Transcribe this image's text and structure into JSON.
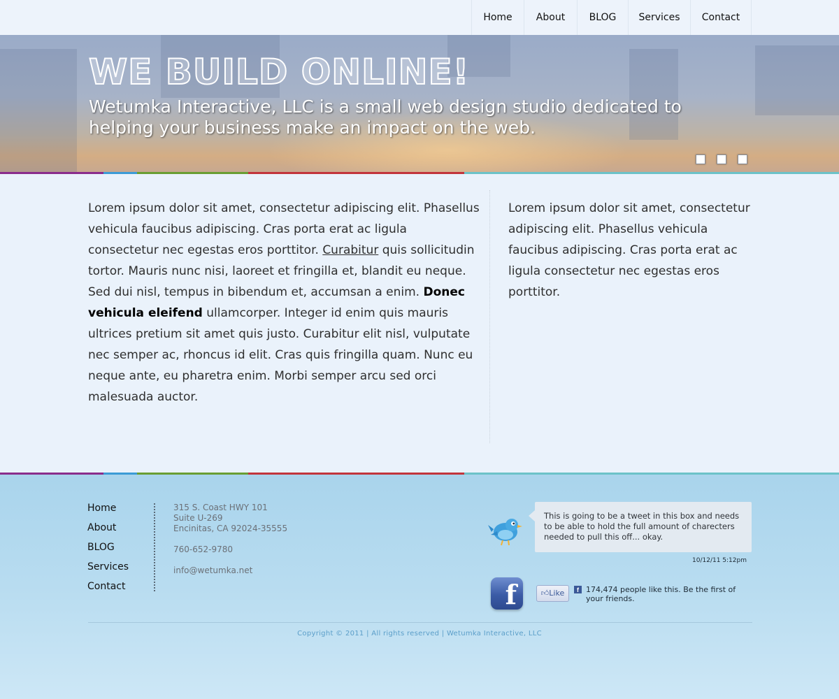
{
  "nav": {
    "items": [
      "Home",
      "About",
      "BLOG",
      "Services",
      "Contact"
    ]
  },
  "hero": {
    "title": "WE BUILD ONLINE!",
    "subtitle": "Wetumka Interactive, LLC is a small web design studio dedicated to helping your business make an impact on the web.",
    "slides": 3
  },
  "main": {
    "left": {
      "text_1": "Lorem ipsum dolor sit amet, consectetur adipiscing elit. Phasellus vehicula faucibus adipiscing. Cras porta erat ac ligula consectetur nec egestas eros porttitor. ",
      "link": "Curabitur",
      "text_2": " quis sollicitudin tortor. Mauris nunc nisi, laoreet et fringilla et, blandit eu neque. Sed dui nisl, tempus in bibendum et, accumsan a enim. ",
      "bold": "Donec vehicula eleifend",
      "text_3": " ullamcorper. Integer id enim quis mauris ultrices pretium sit amet quis justo. Curabitur elit nisl, vulputate nec semper ac, rhoncus id elit. Cras quis fringilla quam. Nunc eu neque ante, eu pharetra enim. Morbi semper arcu sed orci malesuada auctor."
    },
    "right": {
      "text": "Lorem ipsum dolor sit amet, consectetur adipiscing elit. Phasellus vehicula faucibus adipiscing. Cras porta erat ac ligula consectetur nec egestas eros porttitor."
    }
  },
  "footer": {
    "nav": [
      "Home",
      "About",
      "BLOG",
      "Services",
      "Contact"
    ],
    "address": {
      "line1": "315 S. Coast HWY 101",
      "line2": "Suite U-269",
      "line3": "Encinitas, CA 92024-35555",
      "phone": "760-652-9780",
      "email": "info@wetumka.net"
    },
    "tweet": {
      "text": "This is going to be a tweet in this box and needs to be able to hold the full amount of charecters needed to pull this off... okay.",
      "time": "10/12/11 5:12pm",
      "icon": "twitter-bird-icon"
    },
    "facebook": {
      "icon": "facebook-icon",
      "like_label": "Like",
      "count": "174,474",
      "text": " people like this. Be the first of your friends."
    },
    "copyright": "Copyright © 2011 | All rights reserved | Wetumka Interactive, LLC"
  },
  "colors": {
    "stripe": [
      "#8a2d8c",
      "#3c9bd6",
      "#6a9e33",
      "#c2353c",
      "#6cc2c8"
    ],
    "background": "#eaf2fb",
    "footer": "#b8dcf0",
    "copyright": "#5b9ec9"
  }
}
